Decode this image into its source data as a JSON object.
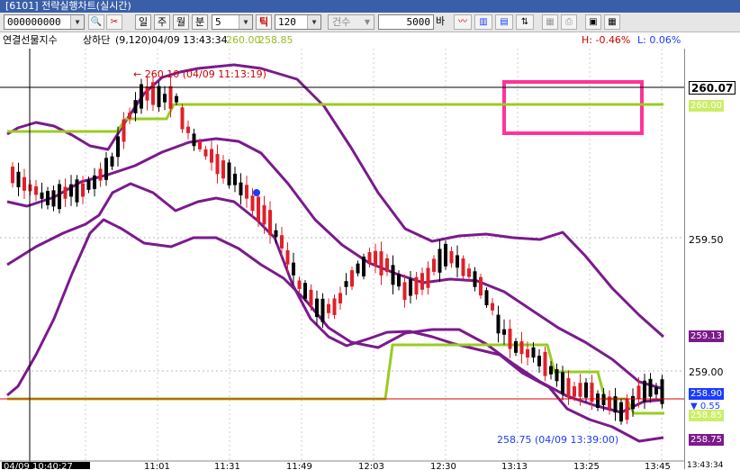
{
  "window": {
    "title": "[6101] 전략실행차트(실시간)"
  },
  "toolbar": {
    "code_value": "000000000",
    "period_buttons": [
      "일",
      "주",
      "월",
      "분"
    ],
    "interval_value": "5",
    "tick_label": "틱",
    "count_value": "120",
    "count_type": "건수",
    "bar_count": "5000",
    "bar_unit": "바"
  },
  "info": {
    "name": "연결선물지수",
    "mode": "상하단",
    "params": "(9,120)",
    "datetime": "04/09 13:43:34",
    "val1": "260.00",
    "val2": "258.85",
    "h_stat": "H: -0.46%",
    "l_stat": "L: 0.06%"
  },
  "annotations": {
    "high_marker": "← 260.10 (04/09 11:13:19)",
    "low_marker": "258.75 (04/09 13:39:00)"
  },
  "axis": {
    "current_price": "260.07",
    "tag_260": "260.00",
    "label_2595": "259.50",
    "tag_purple_upper": "259.13",
    "label_259": "259.00",
    "tag_green": "258.90",
    "tag_change": "▼ 0.55",
    "tag_lower": "258.85",
    "tag_purple_lower": "258.75"
  },
  "time_axis": {
    "cursor_time": "04/09 10:40:27",
    "labels": [
      "11:01",
      "11:31",
      "11:49",
      "12:03",
      "12:30",
      "13:13",
      "13:25",
      "13:45"
    ],
    "right_time": "13:43:34"
  },
  "colors": {
    "candle_up": "#e0202a",
    "candle_down": "#000000",
    "band": "#7b1a8c",
    "green_line": "#99cc22",
    "highlight_box": "#ff3399",
    "blue_dot": "#1a3cff"
  }
}
